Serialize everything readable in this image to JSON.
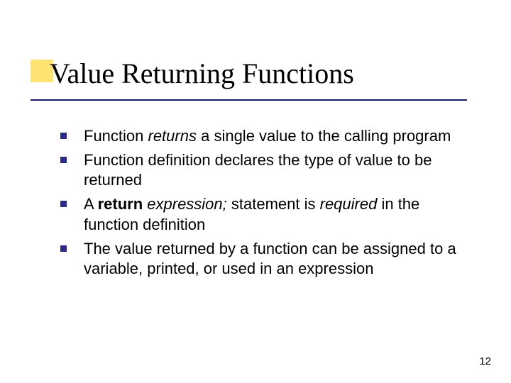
{
  "title": "Value Returning Functions",
  "bullets": [
    {
      "html": "Function <em>returns</em> a single value to the calling program"
    },
    {
      "html": "Function definition declares the type of value to be returned"
    },
    {
      "html": "A <b>return</b> <em>expression;</em> statement is <em>required</em> in the function definition"
    },
    {
      "html": "The value returned by a function can be assigned to a variable, printed, or used in an expression"
    }
  ],
  "page_number": "12"
}
